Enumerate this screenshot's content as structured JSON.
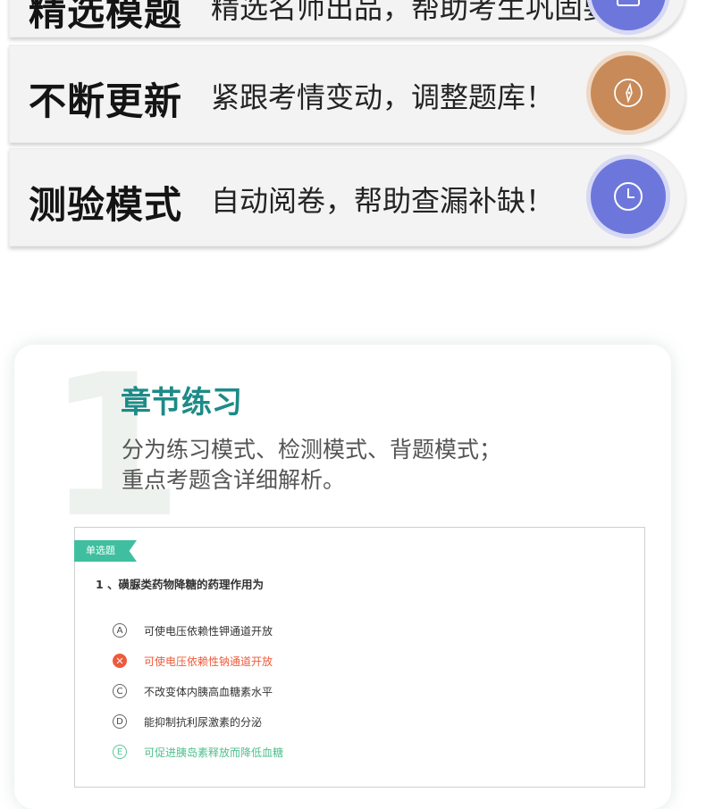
{
  "features": [
    {
      "title": "精选模题",
      "desc": "精选名师出品，帮助考生巩固要点！",
      "icon": "book-icon",
      "color": "#6d77db"
    },
    {
      "title": "不断更新",
      "desc": "紧跟考情变动，调整题库！",
      "icon": "compass-icon",
      "color": "#c88a58"
    },
    {
      "title": "测验模式",
      "desc": "自动阅卷，帮助查漏补缺！",
      "icon": "clock-icon",
      "color": "#6d77db"
    }
  ],
  "section": {
    "number": "1",
    "title": "章节练习",
    "line1": "分为练习模式、检测模式、背题模式；",
    "line2": "重点考题含详细解析。"
  },
  "quiz": {
    "tag": "单选题",
    "question": "1 、磺脲类药物降糖的药理作用为",
    "options": [
      {
        "marker": "A",
        "text": "可使电压依赖性钾通道开放",
        "state": "normal"
      },
      {
        "marker": "✕",
        "text": "可使电压依赖性钠通道开放",
        "state": "wrong"
      },
      {
        "marker": "C",
        "text": "不改变体内胰高血糖素水平",
        "state": "normal"
      },
      {
        "marker": "D",
        "text": "能抑制抗利尿激素的分泌",
        "state": "normal"
      },
      {
        "marker": "E",
        "text": "可促进胰岛素释放而降低血糖",
        "state": "correct"
      }
    ]
  },
  "colors": {
    "accent_teal": "#1d8b87",
    "wrong_red": "#ef5a3c",
    "correct_green": "#59c69a"
  }
}
